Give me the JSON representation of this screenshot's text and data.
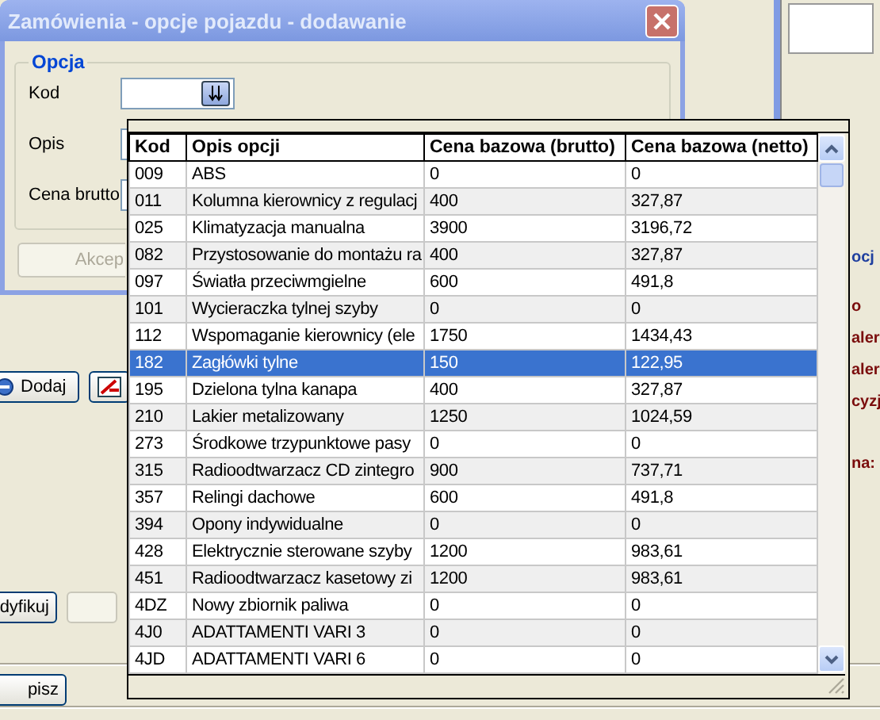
{
  "dialog": {
    "title": "Zamówienia - opcje pojazdu - dodawanie",
    "group": "Opcja",
    "fields": [
      {
        "label": "Kod",
        "kind": "lookup"
      },
      {
        "label": "Opis",
        "kind": "text"
      },
      {
        "label": "Cena brutto",
        "kind": "text"
      }
    ],
    "buttons": [
      {
        "label": "Akcep",
        "disabled": true
      }
    ]
  },
  "lookup": {
    "columns": [
      "Kod",
      "Opis opcji",
      "Cena bazowa (brutto)",
      "Cena bazowa (netto)"
    ],
    "rows": [
      {
        "cells": [
          "009",
          "ABS",
          "0",
          "0"
        ],
        "selected": false
      },
      {
        "cells": [
          "011",
          "Kolumna kierownicy z regulacj",
          "400",
          "327,87"
        ],
        "selected": false
      },
      {
        "cells": [
          "025",
          "Klimatyzacja manualna",
          "3900",
          "3196,72"
        ],
        "selected": false
      },
      {
        "cells": [
          "082",
          "Przystosowanie do montażu ra",
          "400",
          "327,87"
        ],
        "selected": false
      },
      {
        "cells": [
          "097",
          "Światła przeciwmgielne",
          "600",
          "491,8"
        ],
        "selected": false
      },
      {
        "cells": [
          "101",
          "Wycieraczka tylnej szyby",
          "0",
          "0"
        ],
        "selected": false
      },
      {
        "cells": [
          "112",
          "Wspomaganie kierownicy (ele",
          "1750",
          "1434,43"
        ],
        "selected": false
      },
      {
        "cells": [
          "182",
          "Zagłówki tylne",
          "150",
          "122,95"
        ],
        "selected": true
      },
      {
        "cells": [
          "195",
          "Dzielona tylna kanapa",
          "400",
          "327,87"
        ],
        "selected": false
      },
      {
        "cells": [
          "210",
          "Lakier metalizowany",
          "1250",
          "1024,59"
        ],
        "selected": false
      },
      {
        "cells": [
          "273",
          "Środkowe trzypunktowe pasy",
          "0",
          "0"
        ],
        "selected": false
      },
      {
        "cells": [
          "315",
          "Radioodtwarzacz CD zintegro",
          "900",
          "737,71"
        ],
        "selected": false
      },
      {
        "cells": [
          "357",
          "Relingi dachowe",
          "600",
          "491,8"
        ],
        "selected": false
      },
      {
        "cells": [
          "394",
          "Opony indywidualne",
          "0",
          "0"
        ],
        "selected": false
      },
      {
        "cells": [
          "428",
          "Elektrycznie sterowane szyby",
          "1200",
          "983,61"
        ],
        "selected": false
      },
      {
        "cells": [
          "451",
          "Radioodtwarzacz kasetowy zi",
          "1200",
          "983,61"
        ],
        "selected": false
      },
      {
        "cells": [
          "4DZ",
          "Nowy zbiornik paliwa",
          "0",
          "0"
        ],
        "selected": false
      },
      {
        "cells": [
          "4J0",
          "ADATTAMENTI VARI 3",
          "0",
          "0"
        ],
        "selected": false
      },
      {
        "cells": [
          "4JD",
          "ADATTAMENTI VARI 6",
          "0",
          "0"
        ],
        "selected": false
      }
    ]
  },
  "background": {
    "buttons": [
      {
        "label": "Dodaj",
        "kind": "add"
      },
      {
        "label": "dyfikuj",
        "kind": "plain"
      },
      {
        "label": "pisz",
        "kind": "plain"
      }
    ],
    "labels": [
      {
        "text": "ocj",
        "color": "#1f3f9f"
      },
      {
        "text": "o",
        "color": "#7a0c0c"
      },
      {
        "text": "aler",
        "color": "#7a0c0c"
      },
      {
        "text": "aler",
        "color": "#7a0c0c"
      },
      {
        "text": "cyzj",
        "color": "#7a0c0c"
      },
      {
        "text": "na:",
        "color": "#7a0c0c"
      }
    ]
  }
}
